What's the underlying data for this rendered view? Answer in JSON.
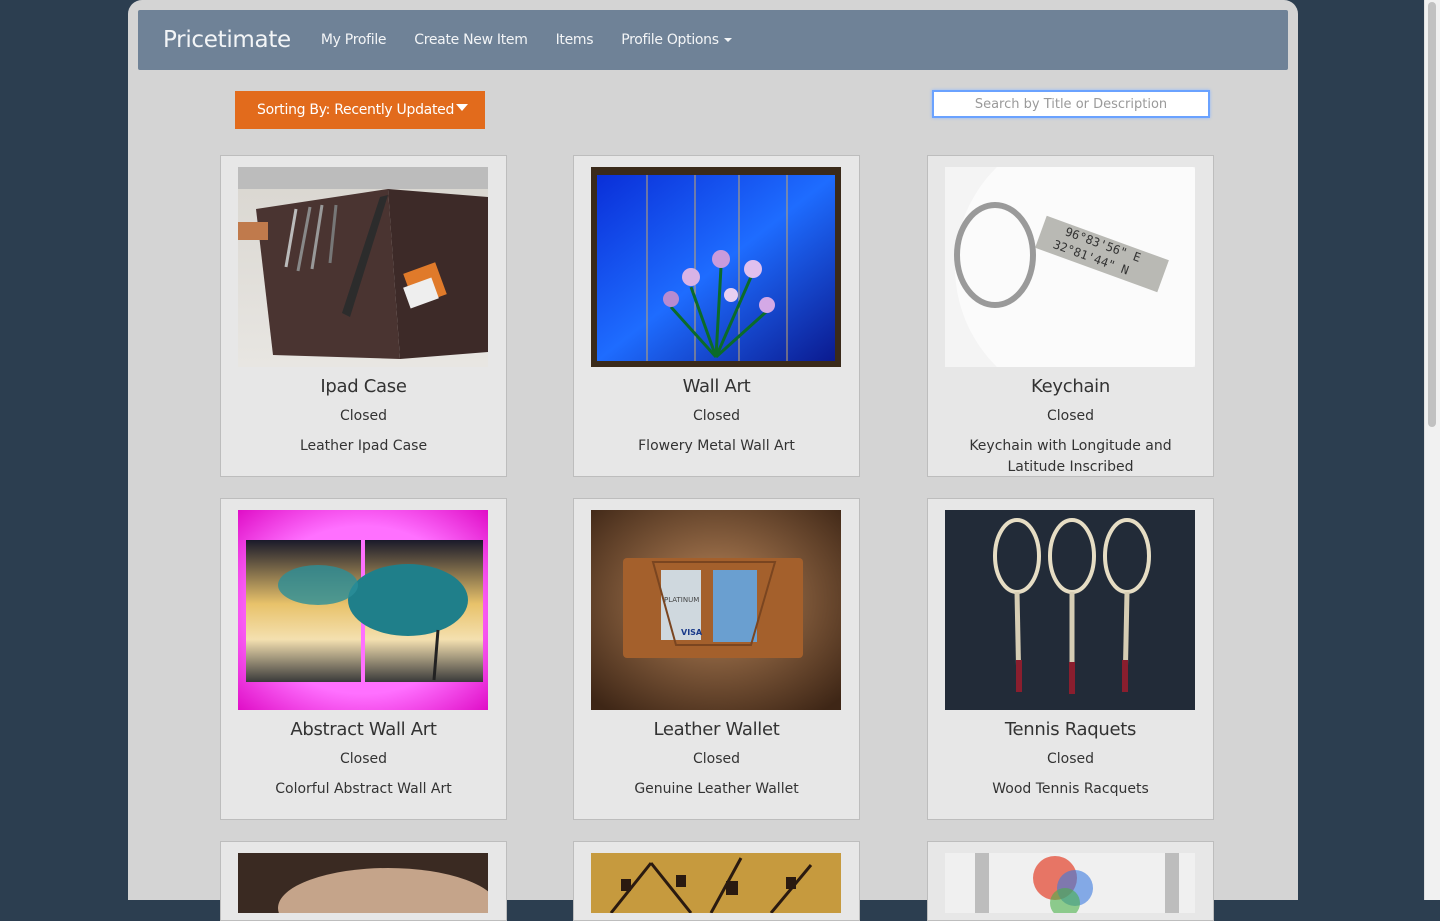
{
  "navbar": {
    "brand": "Pricetimate",
    "links": [
      "My Profile",
      "Create New Item",
      "Items"
    ],
    "dropdown_label": "Profile Options"
  },
  "toolbar": {
    "sort_label": "Sorting By: Recently Updated",
    "search_placeholder": "Search by Title or Description",
    "search_value": ""
  },
  "items": [
    {
      "title": "Ipad Case",
      "status": "Closed",
      "description": "Leather Ipad Case"
    },
    {
      "title": "Wall Art",
      "status": "Closed",
      "description": "Flowery Metal Wall Art"
    },
    {
      "title": "Keychain",
      "status": "Closed",
      "description": "Keychain with Longitude and Latitude Inscribed"
    },
    {
      "title": "Abstract Wall Art",
      "status": "Closed",
      "description": "Colorful Abstract Wall Art"
    },
    {
      "title": "Leather Wallet",
      "status": "Closed",
      "description": "Genuine Leather Wallet"
    },
    {
      "title": "Tennis Raquets",
      "status": "Closed",
      "description": "Wood Tennis Racquets"
    }
  ],
  "images": {
    "keychain_text_1": "96°83'56\" E",
    "keychain_text_2": "32°81'44\" N",
    "card_text_platinum": "PLATINUM",
    "card_text_visa": "VISA"
  }
}
